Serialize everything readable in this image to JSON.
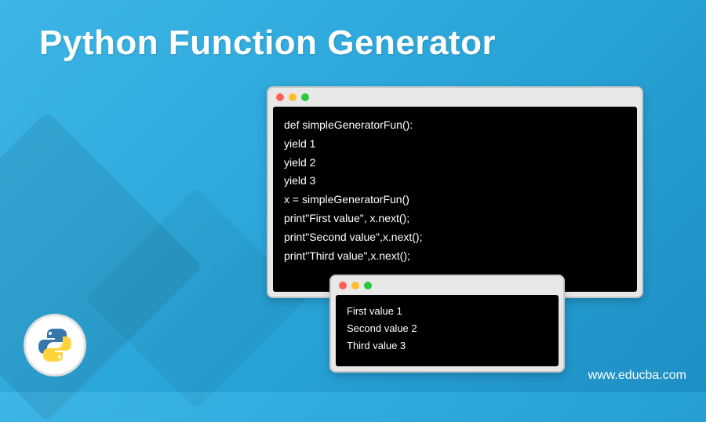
{
  "title": "Python Function Generator",
  "code_window": {
    "lines": [
      "def simpleGeneratorFun():",
      "yield 1",
      "yield 2",
      "yield 3",
      "x = simpleGeneratorFun()",
      "print\"First value\", x.next();",
      "print\"Second value\",x.next();",
      "print\"Third value\",x.next();"
    ]
  },
  "output_window": {
    "lines": [
      "First value 1",
      "Second value 2",
      "Third value 3"
    ]
  },
  "logo": {
    "name": "python-logo"
  },
  "footer_url": "www.educba.com"
}
